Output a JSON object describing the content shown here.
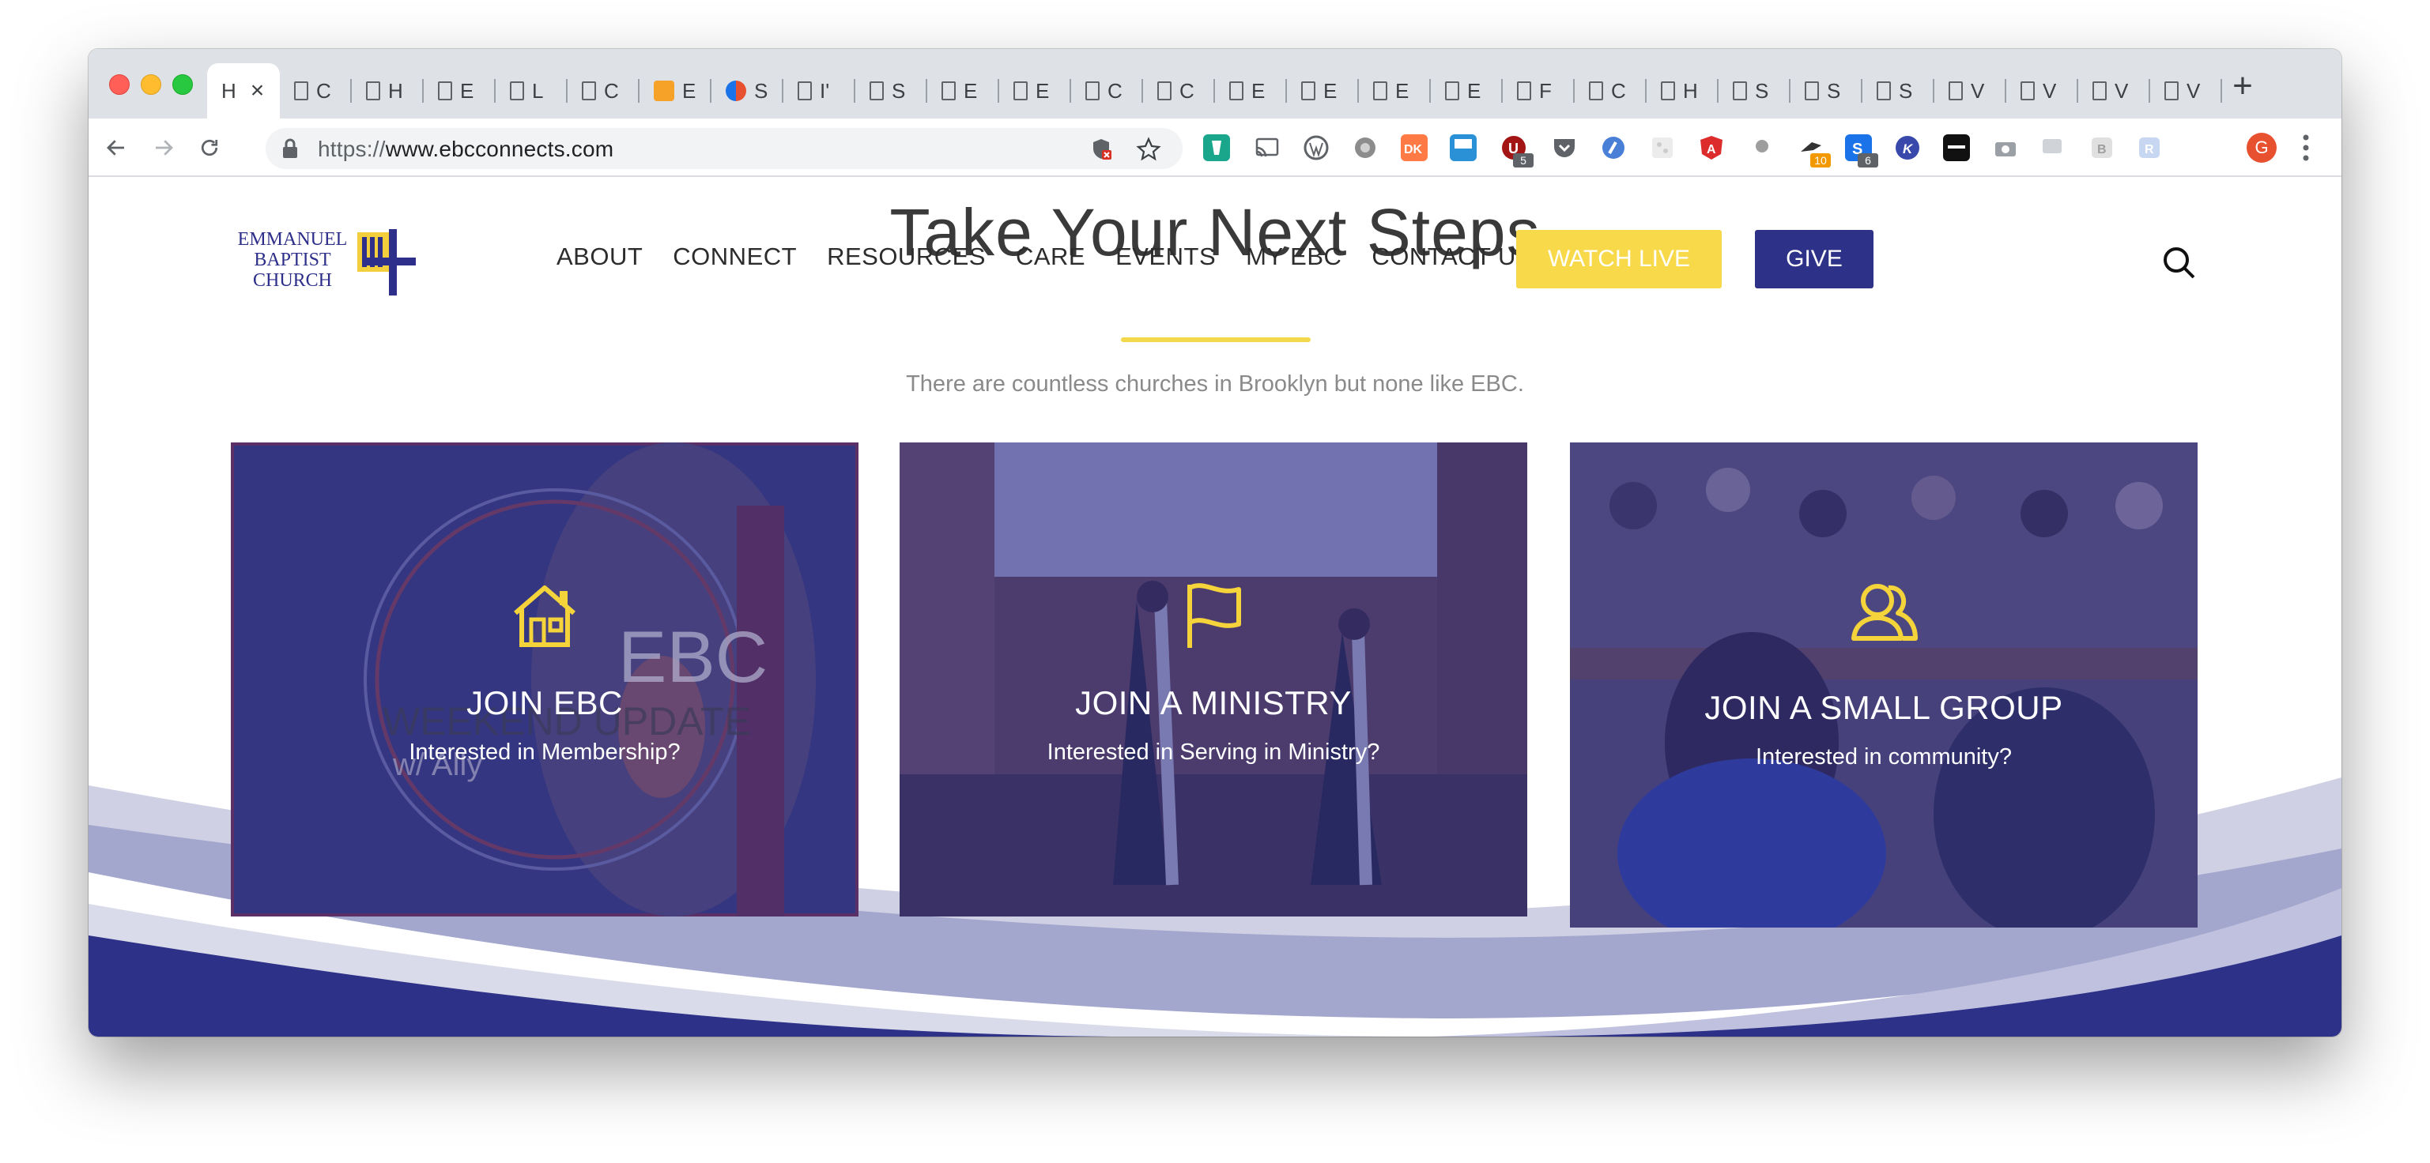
{
  "browser": {
    "tabs": [
      {
        "label": "H",
        "favicon": "page-icon",
        "active": true
      },
      {
        "label": "C",
        "favicon": "page-icon"
      },
      {
        "label": "H",
        "favicon": "page-icon"
      },
      {
        "label": "E",
        "favicon": "page-icon"
      },
      {
        "label": "L",
        "favicon": "page-icon"
      },
      {
        "label": "C",
        "favicon": "page-icon"
      },
      {
        "label": "E",
        "favicon": "orange-extension-icon"
      },
      {
        "label": "S",
        "favicon": "compass-icon"
      },
      {
        "label": "I'",
        "favicon": "page-icon"
      },
      {
        "label": "S",
        "favicon": "page-icon"
      },
      {
        "label": "E",
        "favicon": "page-icon"
      },
      {
        "label": "E",
        "favicon": "page-icon"
      },
      {
        "label": "C",
        "favicon": "page-icon"
      },
      {
        "label": "C",
        "favicon": "page-icon"
      },
      {
        "label": "E",
        "favicon": "page-icon"
      },
      {
        "label": "E",
        "favicon": "page-icon"
      },
      {
        "label": "E",
        "favicon": "page-icon"
      },
      {
        "label": "E",
        "favicon": "page-icon"
      },
      {
        "label": "F",
        "favicon": "page-icon"
      },
      {
        "label": "C",
        "favicon": "page-icon"
      },
      {
        "label": "H",
        "favicon": "page-icon"
      },
      {
        "label": "S",
        "favicon": "page-icon"
      },
      {
        "label": "S",
        "favicon": "page-icon"
      },
      {
        "label": "S",
        "favicon": "page-icon"
      },
      {
        "label": "V",
        "favicon": "page-icon"
      },
      {
        "label": "V",
        "favicon": "page-icon"
      },
      {
        "label": "V",
        "favicon": "page-icon"
      },
      {
        "label": "V",
        "favicon": "page-icon"
      }
    ],
    "tab_close_glyph": "×",
    "new_tab_glyph": "+",
    "url_scheme": "https://",
    "url_host": "www.ebcconnects.com",
    "extension_badges": {
      "u": "5",
      "bird": "10",
      "s": "6"
    },
    "avatar_letter": "G"
  },
  "site": {
    "logo_lines": [
      "EMMANUEL",
      "BAPTIST",
      "CHURCH"
    ],
    "nav": [
      "ABOUT",
      "CONNECT",
      "RESOURCES",
      "CARE",
      "EVENTS",
      "MY EBC",
      "CONTACT US"
    ],
    "watch_live": "WATCH LIVE",
    "give": "GIVE",
    "heading": "Take Your Next Steps",
    "subtitle": "There are countless churches in Brooklyn but none like EBC.",
    "colors": {
      "brand_blue": "#2d3187",
      "accent_yellow": "#f8d94a",
      "overlay": "#30328c"
    },
    "cards": [
      {
        "title": "JOIN EBC",
        "subtitle": "Interested in Membership?",
        "icon": "house-icon",
        "photo_text_big": "EBC",
        "photo_text_mid": "WEEKEND UPDATE",
        "photo_text_small": "w/ Ally"
      },
      {
        "title": "JOIN A MINISTRY",
        "subtitle": "Interested in Serving in Ministry?",
        "icon": "flag-icon"
      },
      {
        "title": "JOIN A SMALL GROUP",
        "subtitle": "Interested in community?",
        "icon": "people-icon"
      }
    ]
  }
}
